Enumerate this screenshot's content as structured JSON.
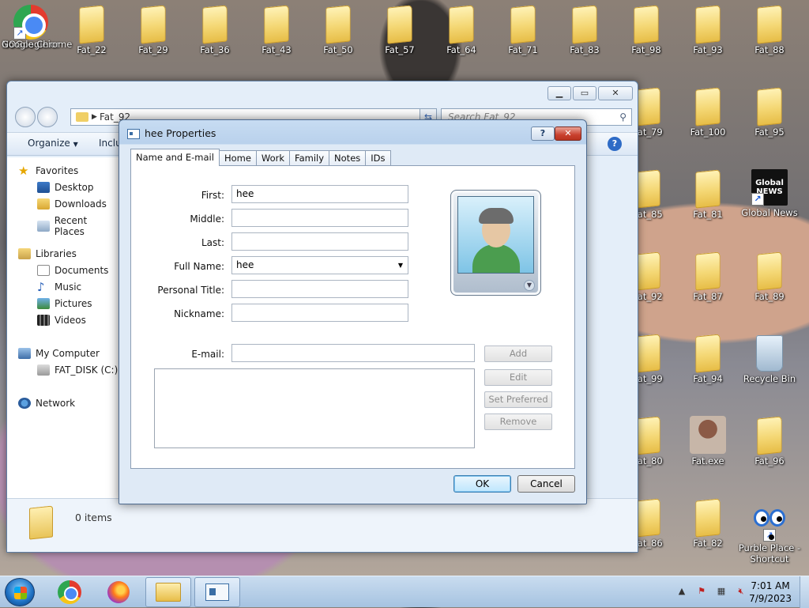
{
  "desktop": {
    "icons": [
      {
        "label": "Google Chrome",
        "overlay_label": "NOGoogleior",
        "kind": "chrome"
      },
      {
        "label": "Fat_22",
        "kind": "folder"
      },
      {
        "label": "Fat_29",
        "kind": "folder"
      },
      {
        "label": "Fat_36",
        "kind": "folder"
      },
      {
        "label": "Fat_43",
        "kind": "folder"
      },
      {
        "label": "Fat_50",
        "kind": "folder"
      },
      {
        "label": "Fat_57",
        "kind": "folder"
      },
      {
        "label": "Fat_64",
        "kind": "folder"
      },
      {
        "label": "Fat_71",
        "kind": "folder"
      },
      {
        "label": "Fat_83",
        "kind": "folder"
      },
      {
        "label": "Fat_98",
        "kind": "folder"
      },
      {
        "label": "Fat_93",
        "kind": "folder"
      },
      {
        "label": "Fat_88",
        "kind": "folder"
      },
      {
        "label": "Fat_79",
        "kind": "folder"
      },
      {
        "label": "Fat_100",
        "kind": "folder"
      },
      {
        "label": "Fat_95",
        "kind": "folder"
      },
      {
        "label": "Fat_85",
        "kind": "folder"
      },
      {
        "label": "Fat_81",
        "kind": "folder"
      },
      {
        "label": "Global News",
        "kind": "news",
        "glyph_text": "Global NEWS"
      },
      {
        "label": "Fat_92",
        "kind": "folder"
      },
      {
        "label": "Fat_87",
        "kind": "folder"
      },
      {
        "label": "Fat_89",
        "kind": "folder"
      },
      {
        "label": "Fat_99",
        "kind": "folder"
      },
      {
        "label": "Fat_94",
        "kind": "folder"
      },
      {
        "label": "Recycle Bin",
        "kind": "bin"
      },
      {
        "label": "Fat_80",
        "kind": "folder"
      },
      {
        "label": "Fat.exe",
        "kind": "person"
      },
      {
        "label": "Fat_96",
        "kind": "folder"
      },
      {
        "label": "Fat_86",
        "kind": "folder"
      },
      {
        "label": "Fat_82",
        "kind": "folder"
      },
      {
        "label": "Purble Place - Shortcut",
        "kind": "eyes"
      }
    ]
  },
  "explorer": {
    "address": "Fat_92",
    "search_placeholder": "Search Fat_92",
    "toolbar": {
      "organize": "Organize",
      "include": "Inclu"
    },
    "nav": {
      "favorites": "Favorites",
      "desktop": "Desktop",
      "downloads": "Downloads",
      "recent": "Recent Places",
      "libraries": "Libraries",
      "documents": "Documents",
      "music": "Music",
      "pictures": "Pictures",
      "videos": "Videos",
      "computer": "My Computer",
      "disk": "FAT_DISK (C:)",
      "network": "Network"
    },
    "status": "0 items"
  },
  "dialog": {
    "title": "hee Properties",
    "tabs": [
      "Name and E-mail",
      "Home",
      "Work",
      "Family",
      "Notes",
      "IDs"
    ],
    "active_tab": 0,
    "fields": {
      "first_label": "First:",
      "first_value": "hee",
      "middle_label": "Middle:",
      "middle_value": "",
      "last_label": "Last:",
      "last_value": "",
      "fullname_label": "Full Name:",
      "fullname_value": "hee",
      "title_label": "Personal Title:",
      "title_value": "",
      "nickname_label": "Nickname:",
      "nickname_value": "",
      "email_label": "E-mail:",
      "email_value": ""
    },
    "buttons": {
      "add": "Add",
      "edit": "Edit",
      "set_preferred": "Set Preferred",
      "remove": "Remove",
      "ok": "OK",
      "cancel": "Cancel",
      "help": "?",
      "close": "✕"
    }
  },
  "taskbar": {
    "time": "7:01 AM",
    "date": "7/9/2023",
    "apps": [
      "chrome",
      "firefox",
      "explorer",
      "contacts"
    ]
  }
}
